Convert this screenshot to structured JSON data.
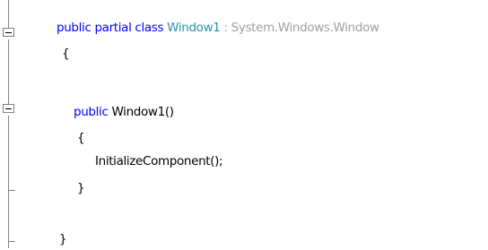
{
  "code": {
    "lines": [
      {
        "keywords": "public partial class",
        "class_name": "Window1",
        "separator": ":",
        "base_type": "System.Windows.Window"
      },
      {
        "text": "{"
      },
      {
        "keyword": "public",
        "text": "Window1()"
      },
      {
        "text": "{"
      },
      {
        "text": "InitializeComponent();"
      },
      {
        "text": "}"
      },
      {
        "text": "}"
      }
    ]
  },
  "colors": {
    "keyword": "#0000ff",
    "type_name": "#2b91af",
    "base_type": "#a0a0a0",
    "plain_text": "#000000",
    "outline_lines": "#808080"
  }
}
